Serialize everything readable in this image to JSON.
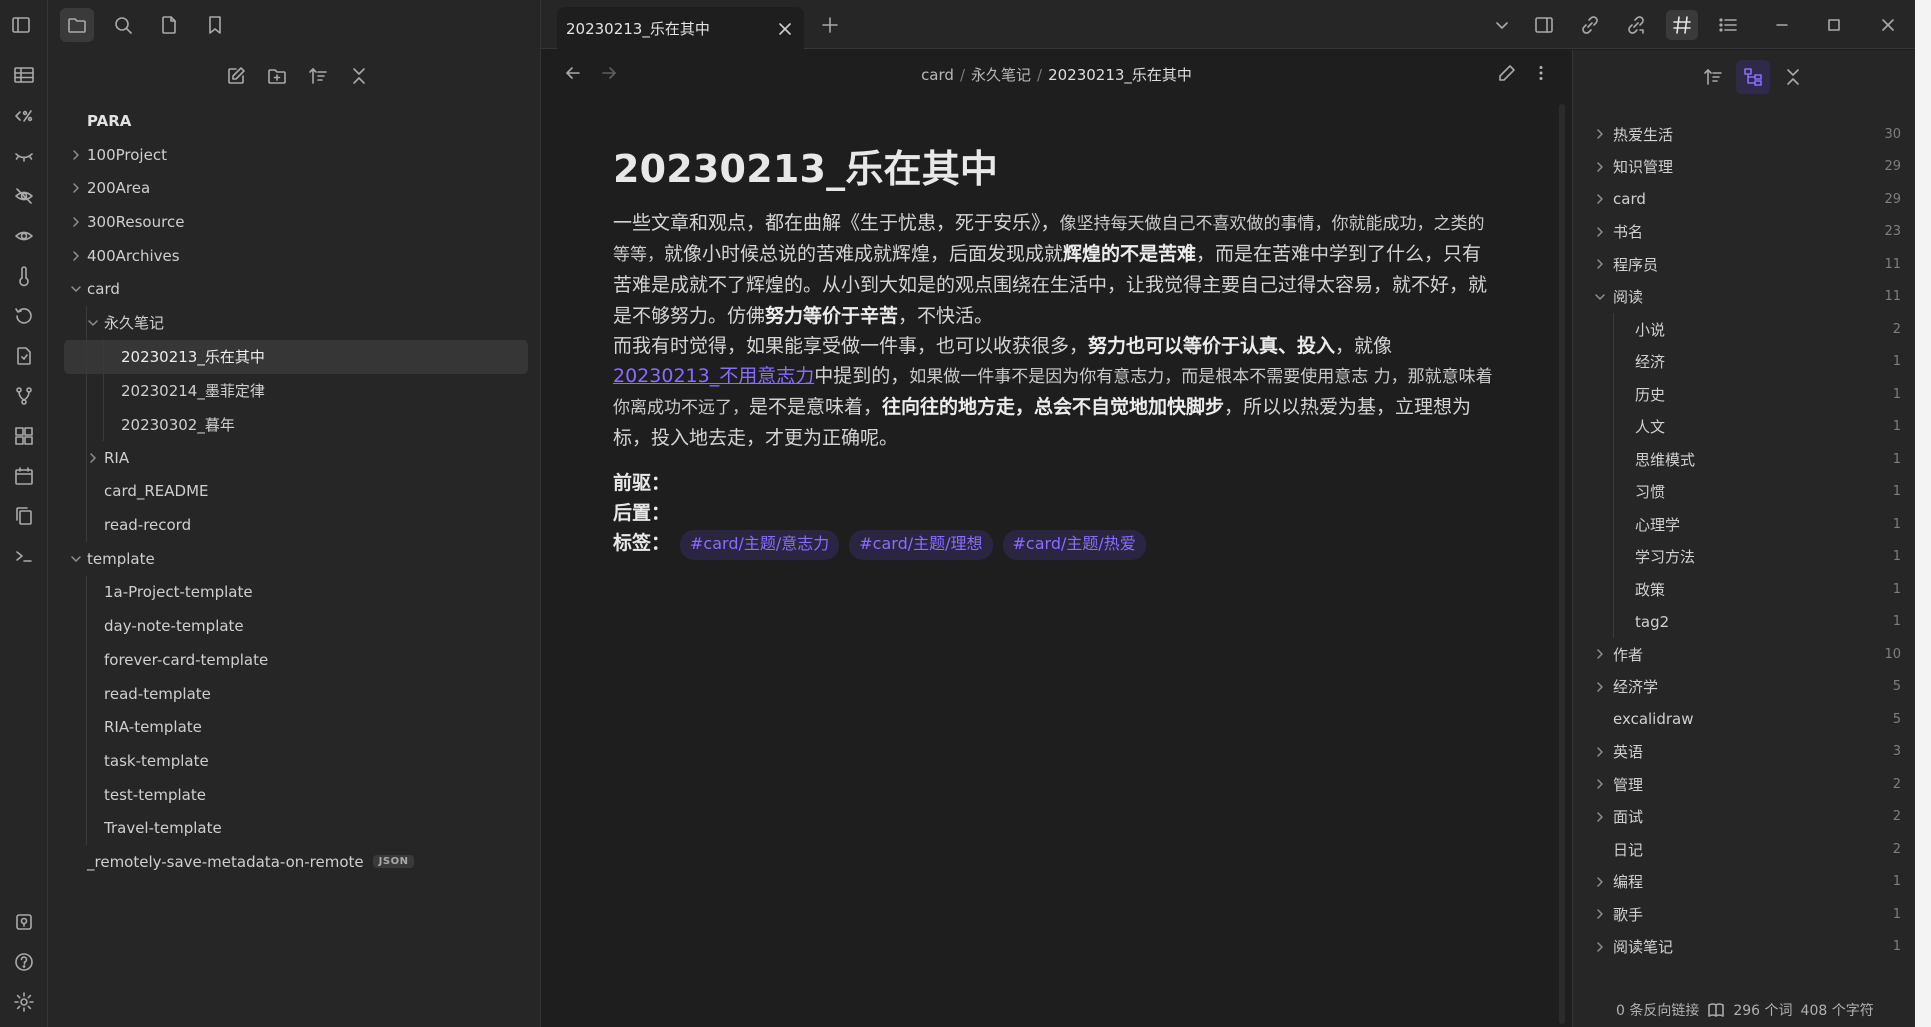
{
  "tab": {
    "title": "20230213_乐在其中"
  },
  "breadcrumb": [
    "card",
    "永久笔记",
    "20230213_乐在其中"
  ],
  "file_tree": [
    {
      "label": "PARA",
      "depth": 0,
      "root": true
    },
    {
      "label": "100Project",
      "depth": 0,
      "caret": "right"
    },
    {
      "label": "200Area",
      "depth": 0,
      "caret": "right"
    },
    {
      "label": "300Resource",
      "depth": 0,
      "caret": "right"
    },
    {
      "label": "400Archives",
      "depth": 0,
      "caret": "right"
    },
    {
      "label": "card",
      "depth": 0,
      "caret": "down"
    },
    {
      "label": "永久笔记",
      "depth": 1,
      "caret": "down"
    },
    {
      "label": "20230213_乐在其中",
      "depth": 2,
      "active": true
    },
    {
      "label": "20230214_墨菲定律",
      "depth": 2
    },
    {
      "label": "20230302_暮年",
      "depth": 2
    },
    {
      "label": "RIA",
      "depth": 1,
      "caret": "right"
    },
    {
      "label": "card_README",
      "depth": 1
    },
    {
      "label": "read-record",
      "depth": 1
    },
    {
      "label": "template",
      "depth": 0,
      "caret": "down"
    },
    {
      "label": "1a-Project-template",
      "depth": 1
    },
    {
      "label": "day-note-template",
      "depth": 1
    },
    {
      "label": "forever-card-template",
      "depth": 1
    },
    {
      "label": "read-template",
      "depth": 1
    },
    {
      "label": "RIA-template",
      "depth": 1
    },
    {
      "label": "task-template",
      "depth": 1
    },
    {
      "label": "test-template",
      "depth": 1
    },
    {
      "label": "Travel-template",
      "depth": 1
    },
    {
      "label": "_remotely-save-metadata-on-remote",
      "depth": 0,
      "badge": "JSON"
    }
  ],
  "note": {
    "title": "20230213_乐在其中",
    "p1_a": "一些文章和观点，都在曲解《生于忧患，死于安乐》，",
    "p1_b": "像坚持每天做自己不喜欢做的事情，你就能成功，之类的等等，",
    "p1_c": "就像小时候总说的苦难成就辉煌，后面发现成就",
    "p1_bold1": "辉煌的不是苦难",
    "p1_d": "，而是在苦难中学到了什么，只有苦难是成就不了辉煌的。从小到大如是的观点围绕在生活中，让我觉得主要自己过得太容易，就不好，就是不够努力。仿佛",
    "p1_bold2": "努力等价于辛苦",
    "p1_e": "，不快活。",
    "p2_a": "而我有时觉得，如果能享受做一件事，也可以收获很多，",
    "p2_bold1": "努力也可以等价于认真、投入",
    "p2_b": "，就像",
    "p2_link": "20230213_不用意志力",
    "p2_c": "中提到的，",
    "p2_d": "如果做一件事不是因为你有意志力，而是根本不需要使用意志 力，那就意味着你离成功不远了，",
    "p2_e": "是不是意味着，",
    "p2_bold2": "往向往的地方走，总会不自觉地加快脚步",
    "p2_f": "，所以以热爱为基，立理想为标，投入地去走，才更为正确呢。",
    "label_prev": "前驱：",
    "label_next": "后置：",
    "label_tags": "标签：",
    "tags": [
      "#card/主题/意志力",
      "#card/主题/理想",
      "#card/主题/热爱"
    ]
  },
  "tag_pane": [
    {
      "label": "热爱生活",
      "count": "30",
      "caret": "right",
      "depth": 0
    },
    {
      "label": "知识管理",
      "count": "29",
      "caret": "right",
      "depth": 0
    },
    {
      "label": "card",
      "count": "29",
      "caret": "right",
      "depth": 0
    },
    {
      "label": "书名",
      "count": "23",
      "caret": "right",
      "depth": 0
    },
    {
      "label": "程序员",
      "count": "11",
      "caret": "right",
      "depth": 0
    },
    {
      "label": "阅读",
      "count": "11",
      "caret": "down",
      "depth": 0
    },
    {
      "label": "小说",
      "count": "2",
      "depth": 1
    },
    {
      "label": "经济",
      "count": "1",
      "depth": 1
    },
    {
      "label": "历史",
      "count": "1",
      "depth": 1
    },
    {
      "label": "人文",
      "count": "1",
      "depth": 1
    },
    {
      "label": "思维模式",
      "count": "1",
      "depth": 1
    },
    {
      "label": "习惯",
      "count": "1",
      "depth": 1
    },
    {
      "label": "心理学",
      "count": "1",
      "depth": 1
    },
    {
      "label": "学习方法",
      "count": "1",
      "depth": 1
    },
    {
      "label": "政策",
      "count": "1",
      "depth": 1
    },
    {
      "label": "tag2",
      "count": "1",
      "depth": 1
    },
    {
      "label": "作者",
      "count": "10",
      "caret": "right",
      "depth": 0
    },
    {
      "label": "经济学",
      "count": "5",
      "caret": "right",
      "depth": 0
    },
    {
      "label": "excalidraw",
      "count": "5",
      "depth": 0
    },
    {
      "label": "英语",
      "count": "3",
      "caret": "right",
      "depth": 0
    },
    {
      "label": "管理",
      "count": "2",
      "caret": "right",
      "depth": 0
    },
    {
      "label": "面试",
      "count": "2",
      "caret": "right",
      "depth": 0
    },
    {
      "label": "日记",
      "count": "2",
      "depth": 0
    },
    {
      "label": "编程",
      "count": "1",
      "caret": "right",
      "depth": 0
    },
    {
      "label": "歌手",
      "count": "1",
      "caret": "right",
      "depth": 0
    },
    {
      "label": "阅读笔记",
      "count": "1",
      "caret": "right",
      "depth": 0
    }
  ],
  "status": {
    "backlinks": "0 条反向链接",
    "words": "296 个词",
    "chars": "408 个字符"
  },
  "colors": {
    "accent": "#8a6cff",
    "background": "#1e1e1e",
    "panel": "#262626"
  }
}
